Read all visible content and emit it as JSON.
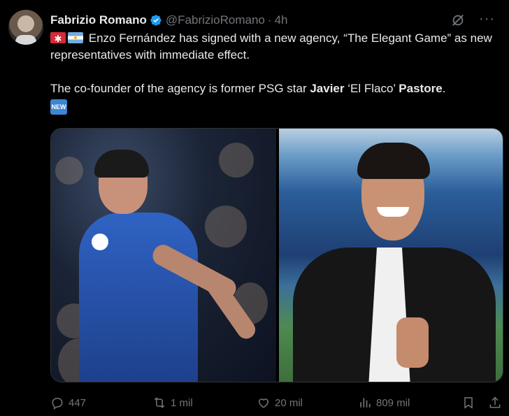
{
  "author": {
    "name": "Fabrizio Romano",
    "handle": "@FabrizioRomano",
    "separator": "·",
    "time": "4h"
  },
  "tweet": {
    "emoji_1": "news-siren-flag",
    "emoji_2": "argentina-flag",
    "line1": "Enzo Fernández has signed with a new agency, “The Elegant Game” as new representatives with immediate effect.",
    "line2_prefix": "The co-founder of the agency is former PSG star ",
    "line2_name_first": "Javier",
    "line2_nickname": " ‘El Flaco’ ",
    "line2_name_last": "Pastore",
    "line2_suffix": ".",
    "badge": "NEW"
  },
  "media": {
    "left": "photo-enzo-fernandez",
    "right": "photo-javier-pastore"
  },
  "actions": {
    "replies": "447",
    "reposts": "1 mil",
    "likes": "20 mil",
    "views": "809 mil"
  },
  "colors": {
    "background": "#000000",
    "text": "#e7e9ea",
    "muted": "#71767b",
    "verified": "#1d9bf0"
  }
}
